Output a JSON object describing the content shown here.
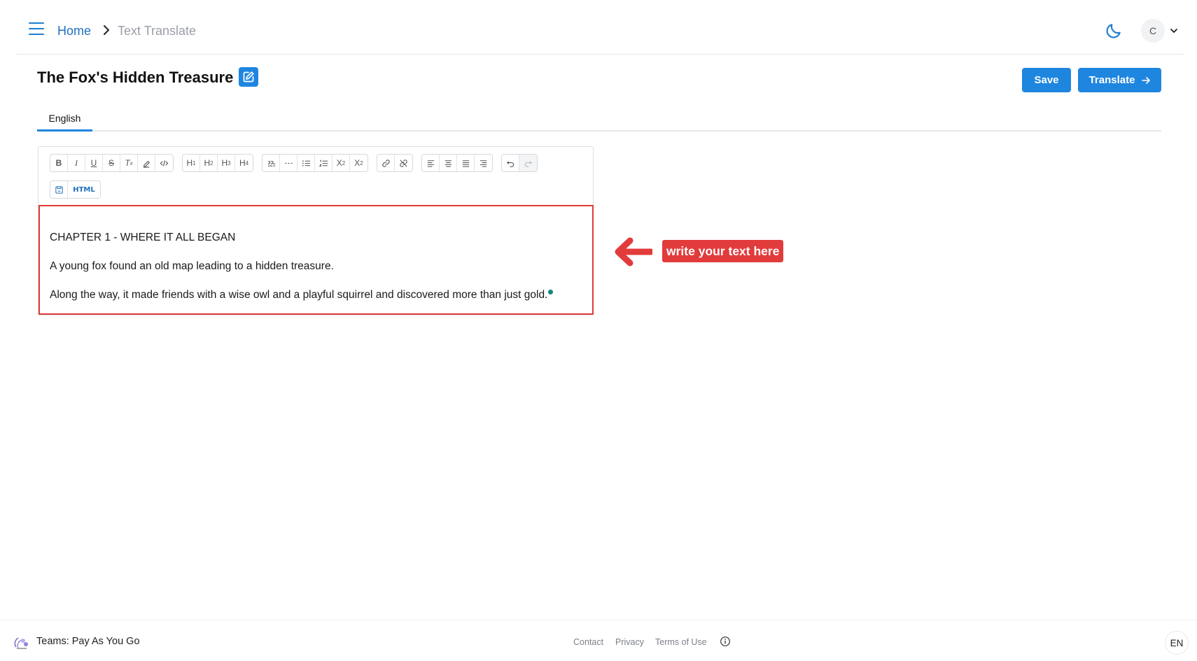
{
  "header": {
    "breadcrumb": {
      "home": "Home",
      "current": "Text Translate"
    },
    "avatar_initial": "C",
    "icons": {
      "menu": "hamburger-icon",
      "theme": "moon-icon",
      "separator": "chevron-right-icon",
      "account": "chevron-down-icon"
    }
  },
  "document": {
    "title": "The Fox's Hidden Treasure",
    "save_label": "Save",
    "translate_label": "Translate"
  },
  "tabs": [
    {
      "label": "English",
      "active": true
    }
  ],
  "editor": {
    "toolbar": {
      "formatting": [
        "B",
        "I",
        "U",
        "S",
        "Tx",
        "highlight",
        "code"
      ],
      "headings": [
        "H1",
        "H2",
        "H3",
        "H4"
      ],
      "blocks": [
        "blockquote",
        "horizontal-rule",
        "bullet-list",
        "ordered-list",
        "subscript",
        "superscript"
      ],
      "links": [
        "link",
        "unlink"
      ],
      "align": [
        "align-left",
        "align-center",
        "align-justify",
        "align-right"
      ],
      "history": [
        "undo",
        "redo"
      ],
      "html_label": "HTML"
    },
    "paragraphs": [
      "CHAPTER 1 - WHERE IT ALL BEGAN",
      "A young fox found an old map leading to a hidden treasure.",
      "Along the way, it made friends with a wise owl and a playful squirrel and discovered more than just gold."
    ]
  },
  "annotation": {
    "text": "write your text here",
    "color": "#e23b3b"
  },
  "footer": {
    "plan": "Teams: Pay As You Go",
    "links": [
      "Contact",
      "Privacy",
      "Terms of Use"
    ],
    "language": "EN"
  },
  "colors": {
    "accent": "#1f86e0",
    "link": "#1f6fbf",
    "highlight_border": "#e23b3b"
  }
}
